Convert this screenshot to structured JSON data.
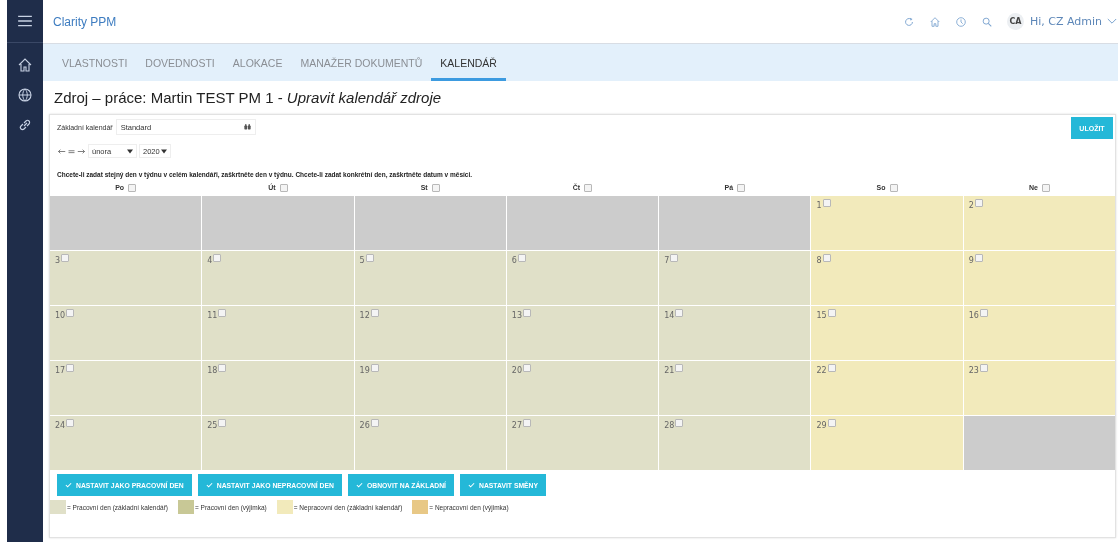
{
  "app": {
    "title": "Clarity PPM",
    "user_initials": "CA",
    "greeting": "Hi, CZ Admin"
  },
  "tabs": [
    {
      "label": "VLASTNOSTI",
      "selected": false
    },
    {
      "label": "DOVEDNOSTI",
      "selected": false
    },
    {
      "label": "ALOKACE",
      "selected": false
    },
    {
      "label": "MANAŽER DOKUMENTŮ",
      "selected": false
    },
    {
      "label": "KALENDÁŘ",
      "selected": true
    }
  ],
  "page_title": "Zdroj – práce: Martin TEST PM 1 - *Upravit kalendář zdroje*",
  "save_button": "ULOŽIT",
  "base_calendar": {
    "label": "Základní kalendář",
    "value": "Standard"
  },
  "month_select": {
    "month": "února",
    "year": "2020"
  },
  "instructions": "Chcete-li zadat stejný den v týdnu v celém kalendáři, zaškrtněte den v týdnu. Chcete-li zadat konkrétní den, zaškrtněte datum v měsíci.",
  "weekdays": [
    {
      "label": "Po",
      "checked": false
    },
    {
      "label": "Út",
      "checked": false
    },
    {
      "label": "St",
      "checked": false
    },
    {
      "label": "Čt",
      "checked": false
    },
    {
      "label": "Pá",
      "checked": false
    },
    {
      "label": "So",
      "checked": false
    },
    {
      "label": "Ne",
      "checked": false
    }
  ],
  "weeks": [
    [
      {
        "kind": "blank"
      },
      {
        "kind": "blank"
      },
      {
        "kind": "blank"
      },
      {
        "kind": "blank"
      },
      {
        "kind": "blank"
      },
      {
        "kind": "nonworking",
        "day": "1",
        "checked": false
      },
      {
        "kind": "nonworking",
        "day": "2",
        "checked": false
      }
    ],
    [
      {
        "kind": "working",
        "day": "3",
        "checked": false
      },
      {
        "kind": "working",
        "day": "4",
        "checked": false
      },
      {
        "kind": "working",
        "day": "5",
        "checked": false
      },
      {
        "kind": "working",
        "day": "6",
        "checked": false
      },
      {
        "kind": "working",
        "day": "7",
        "checked": false
      },
      {
        "kind": "nonworking",
        "day": "8",
        "checked": false
      },
      {
        "kind": "nonworking",
        "day": "9",
        "checked": false
      }
    ],
    [
      {
        "kind": "working",
        "day": "10",
        "checked": false
      },
      {
        "kind": "working",
        "day": "11",
        "checked": false
      },
      {
        "kind": "working",
        "day": "12",
        "checked": false
      },
      {
        "kind": "working",
        "day": "13",
        "checked": false
      },
      {
        "kind": "working",
        "day": "14",
        "checked": false
      },
      {
        "kind": "nonworking",
        "day": "15",
        "checked": false
      },
      {
        "kind": "nonworking",
        "day": "16",
        "checked": false
      }
    ],
    [
      {
        "kind": "working",
        "day": "17",
        "checked": false
      },
      {
        "kind": "working",
        "day": "18",
        "checked": false
      },
      {
        "kind": "working",
        "day": "19",
        "checked": false
      },
      {
        "kind": "working",
        "day": "20",
        "checked": false
      },
      {
        "kind": "working",
        "day": "21",
        "checked": false
      },
      {
        "kind": "nonworking",
        "day": "22",
        "checked": false
      },
      {
        "kind": "nonworking",
        "day": "23",
        "checked": false
      }
    ],
    [
      {
        "kind": "working",
        "day": "24",
        "checked": false
      },
      {
        "kind": "working",
        "day": "25",
        "checked": false
      },
      {
        "kind": "working",
        "day": "26",
        "checked": false
      },
      {
        "kind": "working",
        "day": "27",
        "checked": false
      },
      {
        "kind": "working",
        "day": "28",
        "checked": false
      },
      {
        "kind": "nonworking",
        "day": "29",
        "checked": false
      },
      {
        "kind": "blank"
      }
    ]
  ],
  "actions": [
    "NASTAVIT JAKO PRACOVNÍ DEN",
    "NASTAVIT JAKO NEPRACOVNÍ DEN",
    "OBNOVIT NA ZÁKLADNÍ",
    "NASTAVIT SMĚNY"
  ],
  "legend": [
    {
      "label": "= Pracovní den (základní kalendář)",
      "color": "#e0e0c8"
    },
    {
      "label": "= Pracovní den (výjimka)",
      "color": "#c8c896"
    },
    {
      "label": "= Nepracovní den (základní kalendář)",
      "color": "#f2eabb"
    },
    {
      "label": "= Nepracovní den (výjimka)",
      "color": "#e8c886"
    }
  ]
}
